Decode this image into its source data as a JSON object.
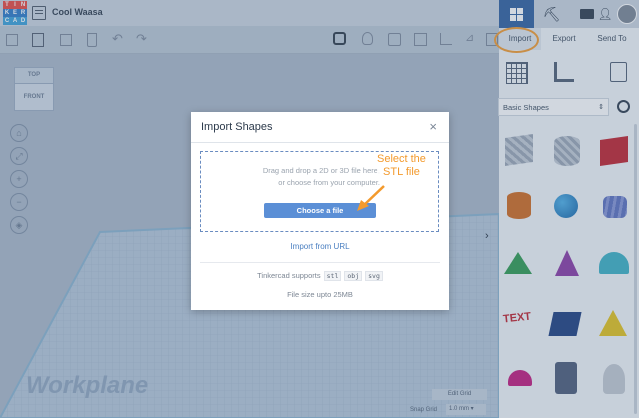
{
  "app": {
    "logo_letters": [
      "T",
      "I",
      "N",
      "K",
      "E",
      "R",
      "C",
      "A",
      "D"
    ],
    "project_name": "Cool Waasa"
  },
  "right_tabs": {
    "import": "Import",
    "export": "Export",
    "send_to": "Send To"
  },
  "shapes_panel": {
    "category": "Basic Shapes"
  },
  "viewcube": {
    "top": "TOP",
    "front": "FRONT"
  },
  "workplane": {
    "label": "Workplane",
    "edit_grid": "Edit Grid",
    "snap_grid_label": "Snap Grid",
    "snap_grid_value": "1.0 mm"
  },
  "modal": {
    "title": "Import Shapes",
    "close": "×",
    "drop_line1": "Drag and drop a 2D or 3D file here,",
    "drop_line2": "or choose from your computer.",
    "choose_button": "Choose a file",
    "import_url": "Import from URL",
    "supports_text": "Tinkercad supports",
    "formats": [
      "stl",
      "obj",
      "svg"
    ],
    "file_size": "File size upto 25MB"
  },
  "annotation": {
    "line1": "Select the",
    "line2": "STL file"
  },
  "colors": {
    "accent_orange": "#f39a2d",
    "button_blue": "#5b8fd6",
    "tab_active": "#2f5f9e"
  }
}
